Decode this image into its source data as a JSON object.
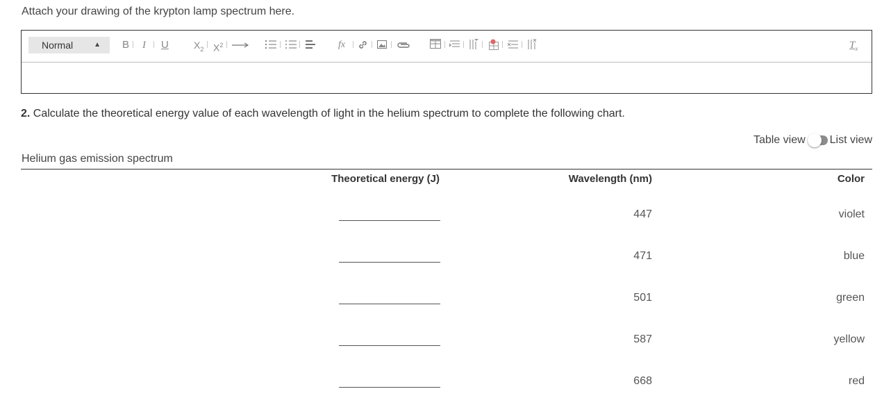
{
  "attach_prompt": "Attach your drawing of the krypton lamp spectrum here.",
  "editor": {
    "format_select": "Normal",
    "toolbar_items": [
      "bold-icon",
      "italic-icon",
      "underline-icon",
      "subscript-icon",
      "superscript-icon",
      "arrow-icon",
      "ordered-list-icon",
      "bullet-list-icon",
      "align-icon",
      "formula-icon",
      "link-icon",
      "image-icon",
      "attachment-icon",
      "table-icon",
      "insert-row-icon",
      "insert-column-icon",
      "delete-table-icon",
      "delete-row-icon",
      "delete-column-icon",
      "clear-format-icon"
    ],
    "body_text": ""
  },
  "question": {
    "number": "2.",
    "text": "Calculate the theoretical energy value of each wavelength of light in the helium spectrum to complete the following chart."
  },
  "view_toggle": {
    "left_label": "Table view",
    "right_label": "List view"
  },
  "table": {
    "caption": "Helium gas emission spectrum",
    "headers": {
      "energy": "Theoretical energy (J)",
      "wavelength": "Wavelength (nm)",
      "color": "Color"
    },
    "rows": [
      {
        "energy": "",
        "wavelength": "447",
        "color": "violet"
      },
      {
        "energy": "",
        "wavelength": "471",
        "color": "blue"
      },
      {
        "energy": "",
        "wavelength": "501",
        "color": "green"
      },
      {
        "energy": "",
        "wavelength": "587",
        "color": "yellow"
      },
      {
        "energy": "",
        "wavelength": "668",
        "color": "red"
      }
    ]
  }
}
